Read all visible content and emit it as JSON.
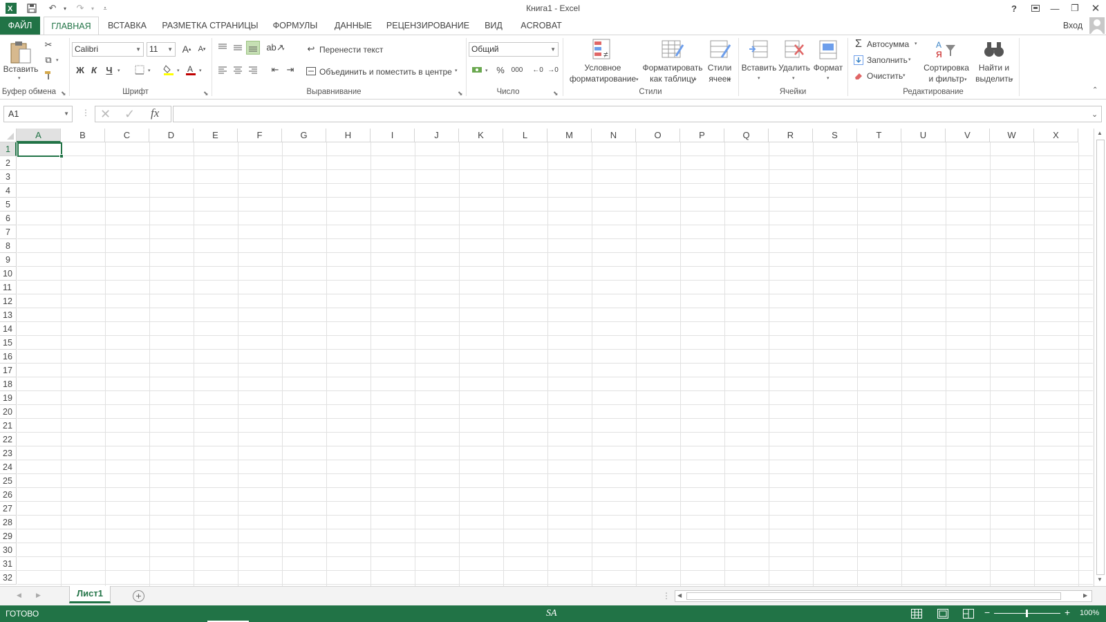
{
  "window": {
    "title": "Книга1 - Excel",
    "signin": "Вход",
    "help": "?",
    "qat": {
      "save_icon": "save-icon",
      "undo_icon": "undo-icon",
      "redo_icon": "redo-icon"
    }
  },
  "tabs": [
    {
      "label": "ФАЙЛ"
    },
    {
      "label": "ГЛАВНАЯ"
    },
    {
      "label": "ВСТАВКА"
    },
    {
      "label": "РАЗМЕТКА СТРАНИЦЫ"
    },
    {
      "label": "ФОРМУЛЫ"
    },
    {
      "label": "ДАННЫЕ"
    },
    {
      "label": "РЕЦЕНЗИРОВАНИЕ"
    },
    {
      "label": "ВИД"
    },
    {
      "label": "ACROBAT"
    }
  ],
  "ribbon": {
    "clipboard": {
      "label": "Буфер обмена",
      "paste": "Вставить"
    },
    "font": {
      "label": "Шрифт",
      "name": "Calibri",
      "size": "11",
      "bold": "Ж",
      "italic": "К",
      "underline": "Ч"
    },
    "alignment": {
      "label": "Выравнивание",
      "wrap": "Перенести текст",
      "merge": "Объединить и поместить в центре"
    },
    "number": {
      "label": "Число",
      "format": "Общий",
      "percent": "%",
      "thousands": "000"
    },
    "styles": {
      "label": "Стили",
      "conditional_1": "Условное",
      "conditional_2": "форматирование",
      "table_1": "Форматировать",
      "table_2": "как таблицу",
      "cell_1": "Стили",
      "cell_2": "ячеек"
    },
    "cells": {
      "label": "Ячейки",
      "insert": "Вставить",
      "delete": "Удалить",
      "format": "Формат"
    },
    "editing": {
      "label": "Редактирование",
      "autosum": "Автосумма",
      "fill": "Заполнить",
      "clear": "Очистить",
      "sort_1": "Сортировка",
      "sort_2": "и фильтр",
      "find_1": "Найти и",
      "find_2": "выделить"
    }
  },
  "formula_bar": {
    "name_box": "A1",
    "fx": "fx",
    "value": ""
  },
  "grid": {
    "columns": [
      "A",
      "B",
      "C",
      "D",
      "E",
      "F",
      "G",
      "H",
      "I",
      "J",
      "K",
      "L",
      "M",
      "N",
      "O",
      "P",
      "Q",
      "R",
      "S",
      "T",
      "U",
      "V",
      "W",
      "X"
    ],
    "rows": [
      "1",
      "2",
      "3",
      "4",
      "5",
      "6",
      "7",
      "8",
      "9",
      "10",
      "11",
      "12",
      "13",
      "14",
      "15",
      "16",
      "17",
      "18",
      "19",
      "20",
      "21",
      "22",
      "23",
      "24",
      "25",
      "26",
      "27",
      "28",
      "29",
      "30",
      "31",
      "32"
    ],
    "selected_cell": "A1"
  },
  "sheets": [
    {
      "label": "Лист1",
      "active": true
    }
  ],
  "status": {
    "ready": "ГОТОВО",
    "center": "SA",
    "zoom": "100%"
  },
  "colors": {
    "accent": "#217346",
    "gridline": "#e1e1e1",
    "header_border": "#d4d4d4"
  }
}
